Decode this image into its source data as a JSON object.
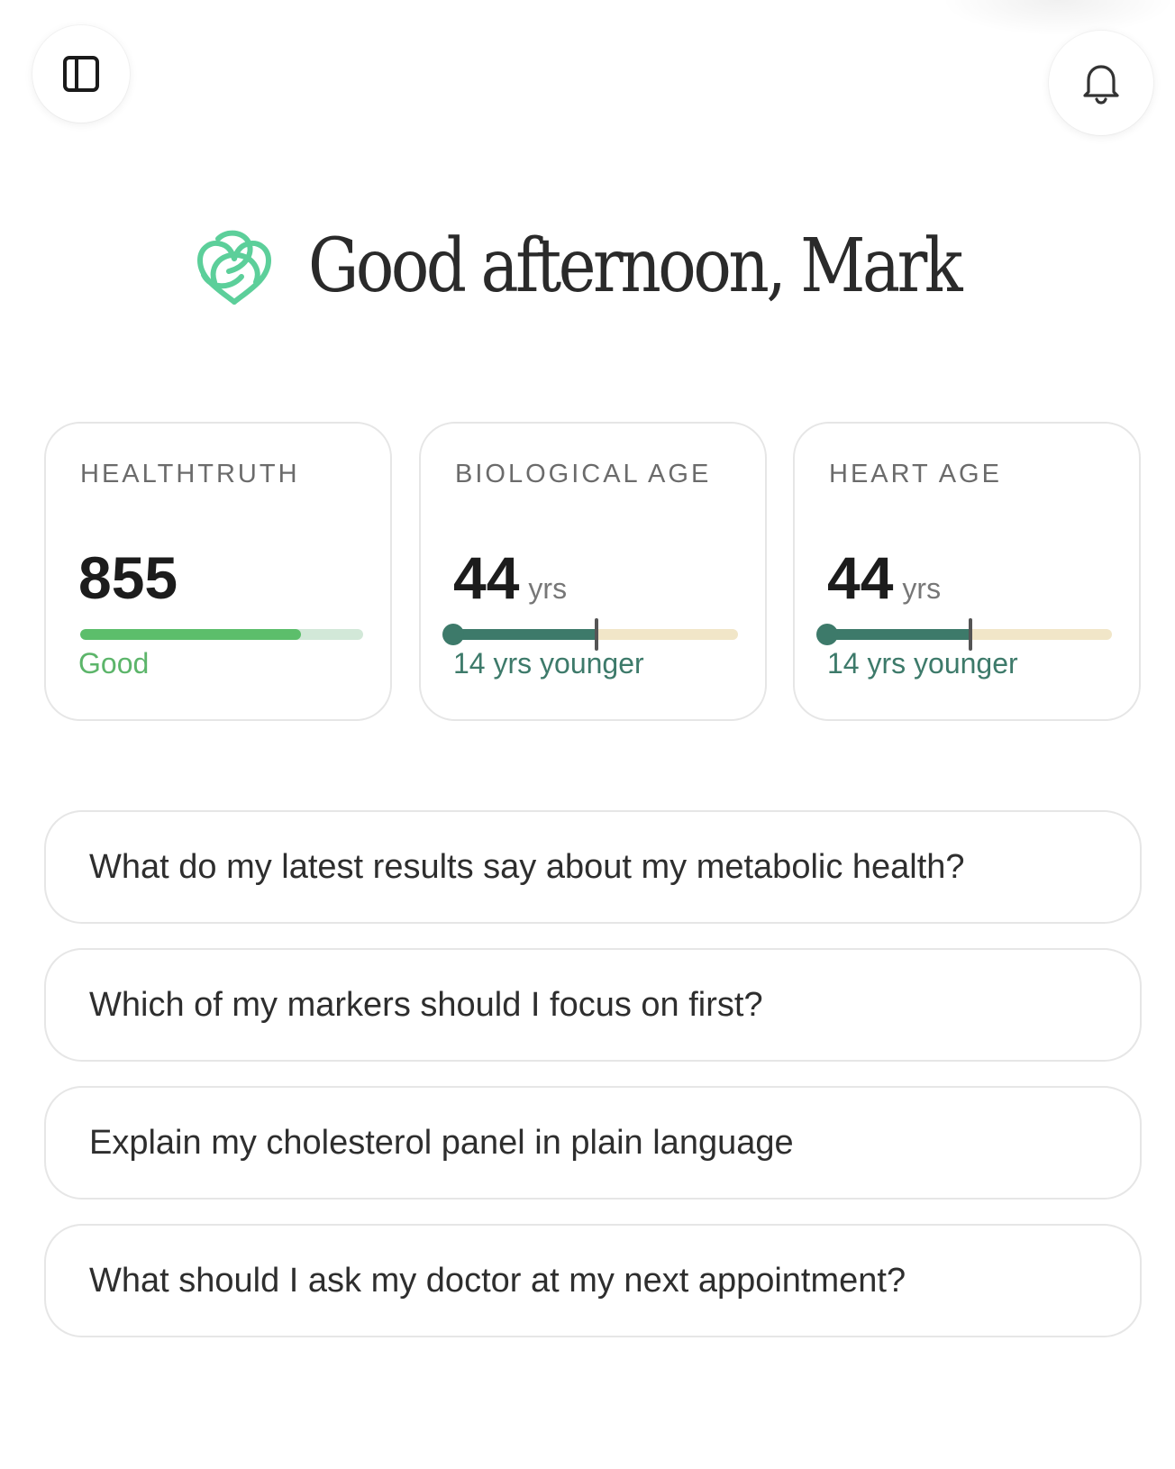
{
  "header": {
    "sidebar_icon": "sidebar-toggle-icon",
    "bell_icon": "bell-icon"
  },
  "greeting": {
    "logo_icon": "heart-knot-logo",
    "text": "Good afternoon, Mark"
  },
  "colors": {
    "logo_green": "#5ccf9a",
    "good_green": "#5cbe6b",
    "age_teal": "#3d7a6a",
    "age_track": "#f1e6c8"
  },
  "cards": [
    {
      "label": "HEALTHTRUTH",
      "value": "855",
      "unit": "",
      "status": "Good",
      "progress": 0.78
    },
    {
      "label": "BIOLOGICAL AGE",
      "value": "44",
      "unit": "yrs",
      "status": "14 yrs younger",
      "progress": 0.5
    },
    {
      "label": "HEART AGE",
      "value": "44",
      "unit": "yrs",
      "status": "14 yrs younger",
      "progress": 0.5
    }
  ],
  "prompts": [
    "What do my latest results say about my metabolic health?",
    "Which of my markers should I focus on first?",
    "Explain my cholesterol panel in plain language",
    "What should I ask my doctor at my next appointment?"
  ]
}
